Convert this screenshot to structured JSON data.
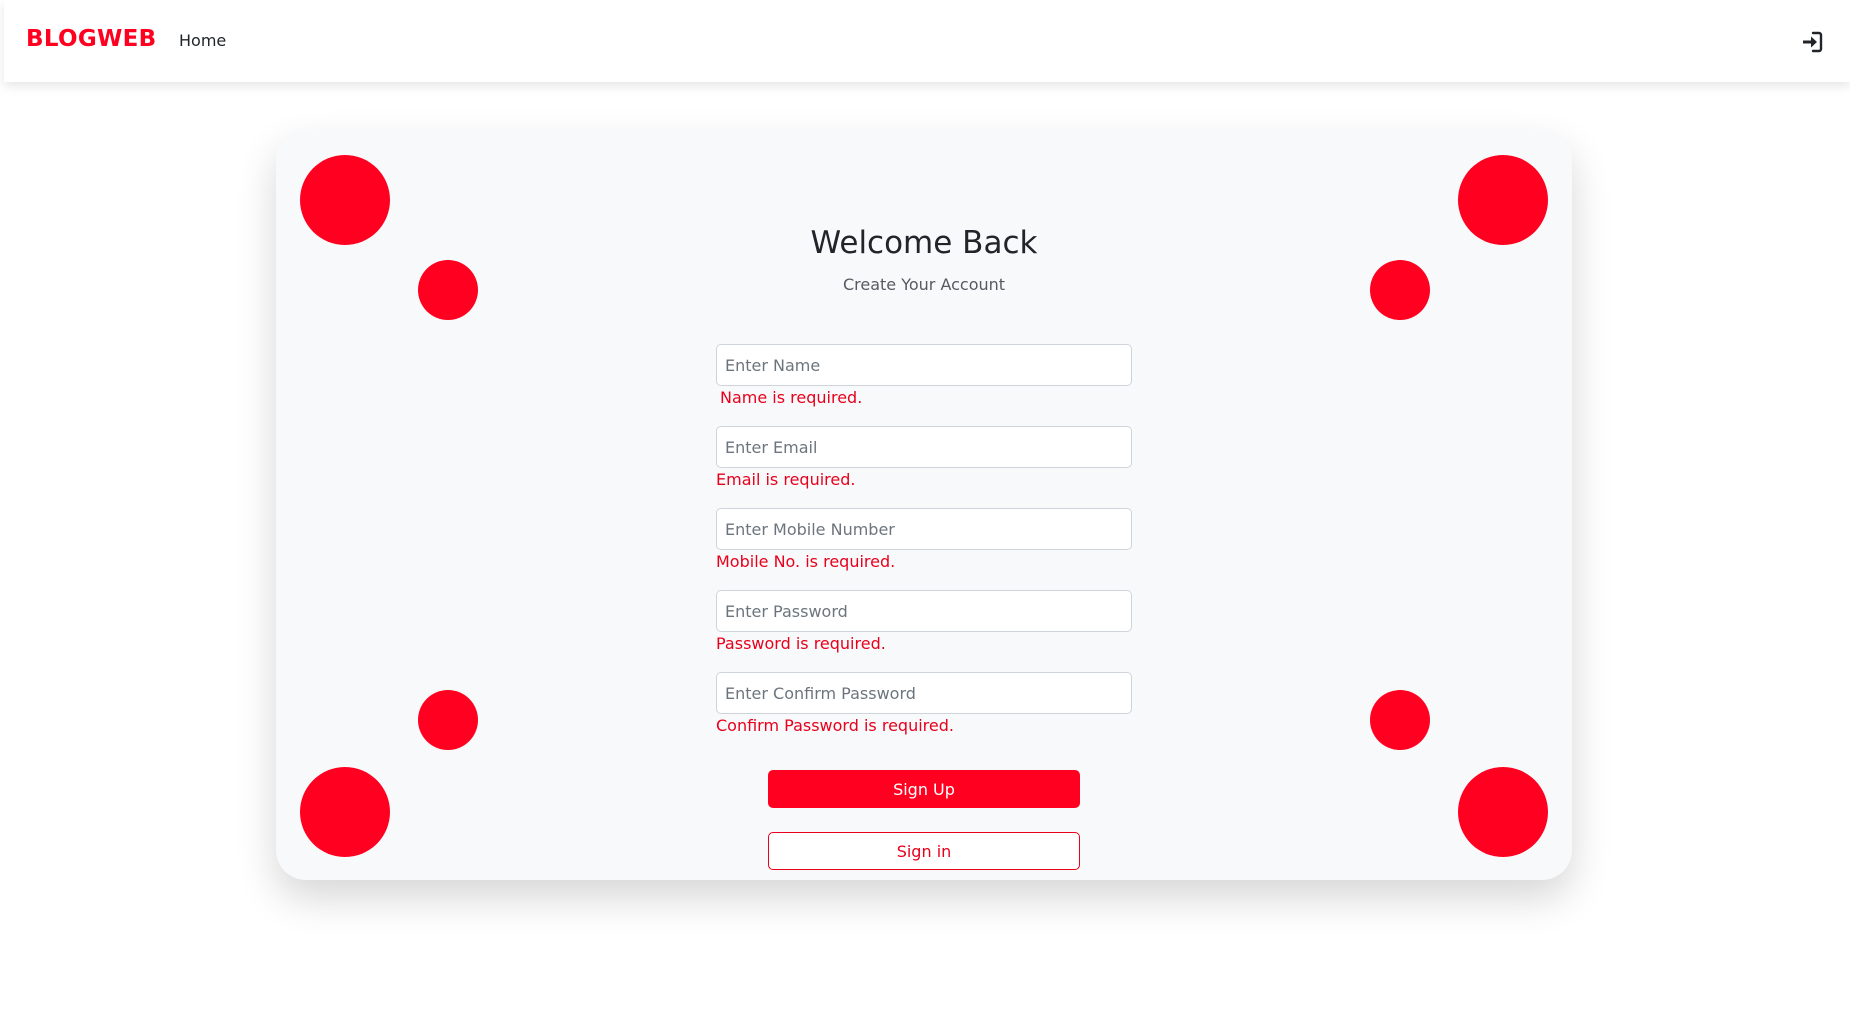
{
  "navbar": {
    "brand": "BLOGWEB",
    "home_label": "Home",
    "login_icon": "sign-in-icon"
  },
  "form": {
    "title": "Welcome Back",
    "subtitle": "Create Your Account",
    "fields": [
      {
        "placeholder": "Enter Name",
        "value": "",
        "error": "Name is required."
      },
      {
        "placeholder": "Enter Email",
        "value": "",
        "error": "Email is required."
      },
      {
        "placeholder": "Enter Mobile Number",
        "value": "",
        "error": "Mobile No. is required."
      },
      {
        "placeholder": "Enter Password",
        "value": "",
        "error": "Password is required."
      },
      {
        "placeholder": "Enter Confirm Password",
        "value": "",
        "error": "Confirm Password is required."
      }
    ],
    "signup_label": "Sign Up",
    "signin_label": "Sign in"
  },
  "colors": {
    "accent": "#ff0020",
    "error": "#e8001c",
    "card_background": "#f8f9fa"
  }
}
